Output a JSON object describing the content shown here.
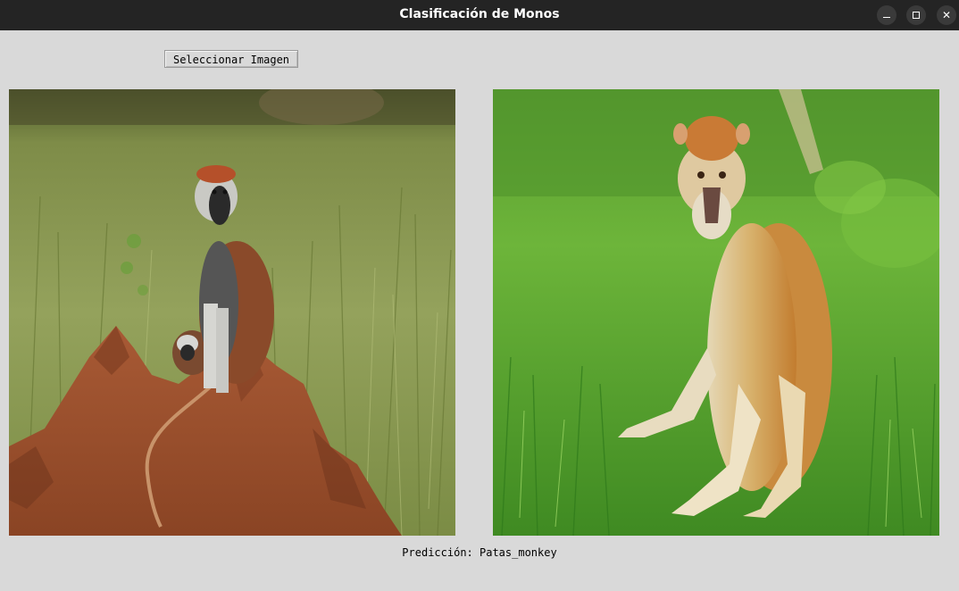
{
  "window": {
    "title": "Clasificación de Monos",
    "controls": {
      "minimize_icon": "minimize-icon",
      "maximize_icon": "maximize-icon",
      "close_icon": "close-icon",
      "close_glyph": "✕"
    }
  },
  "toolbar": {
    "select_image_label": "Seleccionar Imagen"
  },
  "images": {
    "original": {
      "subject": "patas-monkey-on-termite-mound",
      "colors": {
        "grass": "#8a9a52",
        "grass_dark": "#5f6d35",
        "mound": "#9a4f2c",
        "monkey_fur": "#8a4a2a"
      }
    },
    "processed": {
      "subject": "patas-monkey-on-grass",
      "colors": {
        "grass": "#4fa22e",
        "grass_dark": "#2f7a1b",
        "monkey_fur": "#c98a3e",
        "monkey_pale": "#e8d9b5"
      }
    }
  },
  "result": {
    "prediction_text": "Predicción: Patas_monkey"
  }
}
